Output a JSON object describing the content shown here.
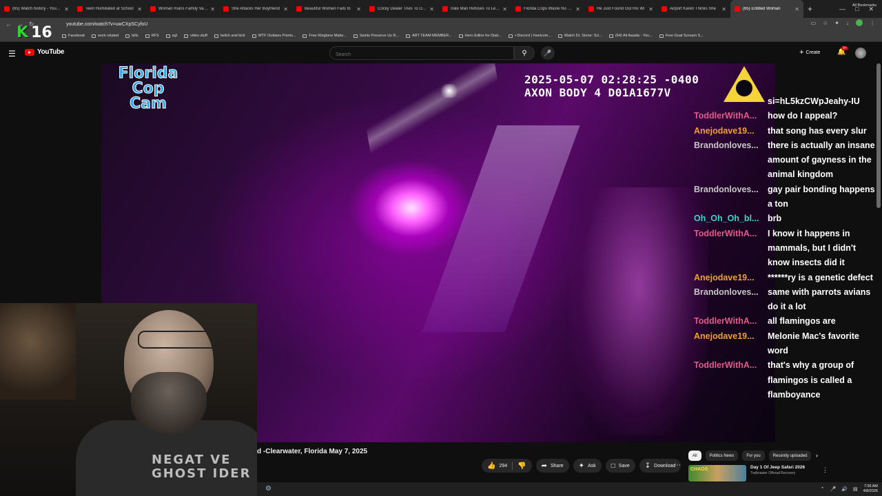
{
  "browser": {
    "tabs": [
      {
        "label": "(65) Watch history - YouTube",
        "active": false
      },
      {
        "label": "Teen Humiliated at School",
        "active": false
      },
      {
        "label": "Woman Ruins Family Vacation",
        "active": false
      },
      {
        "label": "She Attacks Her Boyfriend",
        "active": false
      },
      {
        "label": "Beautiful Women Fails to",
        "active": false
      },
      {
        "label": "Cocky Dealer Tries To Outs",
        "active": false
      },
      {
        "label": "Irate Man Refuses To Leave",
        "active": false
      },
      {
        "label": "Florida Cops Waste No Time",
        "active": false
      },
      {
        "label": "He Just Found Out His Wi",
        "active": false
      },
      {
        "label": "Airport Karen Thinks She",
        "active": false
      },
      {
        "label": "(65) Entitled Woman",
        "active": true
      }
    ],
    "new_tab": "+",
    "url": "youtube.com/watch?v=uwCXpSCyfoU",
    "bookmarks": [
      "Facebook",
      "work related",
      "bills",
      "RFS",
      "egl",
      "video stuff",
      "twitch and kick",
      "WTF Outlaws Points...",
      "Free Ringtone Make...",
      "Saints Preserve Us R...",
      "ART TEAM MEMBER...",
      "Hero Editor for Diab...",
      "• Discord | #welcom...",
      "Watch Dr. Stone: Sci...",
      "(64) Ali Awada - You...",
      "Free Goat Scream S..."
    ],
    "all_bookmarks": "All Bookmarks",
    "overlay_logo_letter": "K",
    "overlay_logo_number": "16"
  },
  "youtube": {
    "logo_text": "YouTube",
    "search_placeholder": "Search",
    "create_label": "Create",
    "notifications_badge": "9+"
  },
  "video": {
    "watermark_lines": [
      "Florida",
      "Cop",
      "Cam"
    ],
    "timestamp_line1": "2025-05-07 02:28:25 -0400",
    "timestamp_line2": "AXON BODY 4 D01A1677V",
    "title": "d -Clearwater, Florida May 7, 2025"
  },
  "chat": {
    "messages": [
      {
        "user": "",
        "color": "#ffffff",
        "text": "si=hL5kzCWpJeahy-IU"
      },
      {
        "user": "ToddlerWithA...",
        "color": "#e05a8a",
        "text": "how do I appeal?"
      },
      {
        "user": "Anejodave19...",
        "color": "#f0a030",
        "text": "that song has every slur"
      },
      {
        "user": "Brandonloves...",
        "color": "#c8c8c8",
        "text": "there is actually an insane amount of gayness in the animal kingdom"
      },
      {
        "user": "Brandonloves...",
        "color": "#c8c8c8",
        "text": "gay pair bonding happens a ton"
      },
      {
        "user": "Oh_Oh_Oh_bl...",
        "color": "#3fd6c8",
        "text": "brb"
      },
      {
        "user": "ToddlerWithA...",
        "color": "#e05a8a",
        "text": "I know it happens in mammals, but I didn't know insects did it"
      },
      {
        "user": "Anejodave19...",
        "color": "#f0a030",
        "text": "******ry is a genetic defect"
      },
      {
        "user": "Brandonloves...",
        "color": "#c8c8c8",
        "text": "same with parrots avians do it a lot"
      },
      {
        "user": "ToddlerWithA...",
        "color": "#e05a8a",
        "text": "all flamingos are"
      },
      {
        "user": "Anejodave19...",
        "color": "#f0a030",
        "text": "Melonie Mac's favorite word"
      },
      {
        "user": "ToddlerWithA...",
        "color": "#e05a8a",
        "text": "that's why a group of flamingos is called a flamboyance"
      }
    ]
  },
  "webcam": {
    "shirt_lines": [
      "NEGAT VE",
      "GHOST IDER"
    ]
  },
  "actions": {
    "like_count": "294",
    "share": "Share",
    "ask": "Ask",
    "save": "Save",
    "download": "Download"
  },
  "sidebar": {
    "chips": [
      "All",
      "Politics News",
      "For you",
      "Recently uploaded"
    ],
    "recommendation": {
      "thumb_text": "CHAOS",
      "title": "Day 1 Of Jeep Safari 2026",
      "channel": "Trailmaster Offroad Recovery"
    }
  },
  "taskbar": {
    "time": "7:36 AM",
    "date": "4/8/2026"
  }
}
